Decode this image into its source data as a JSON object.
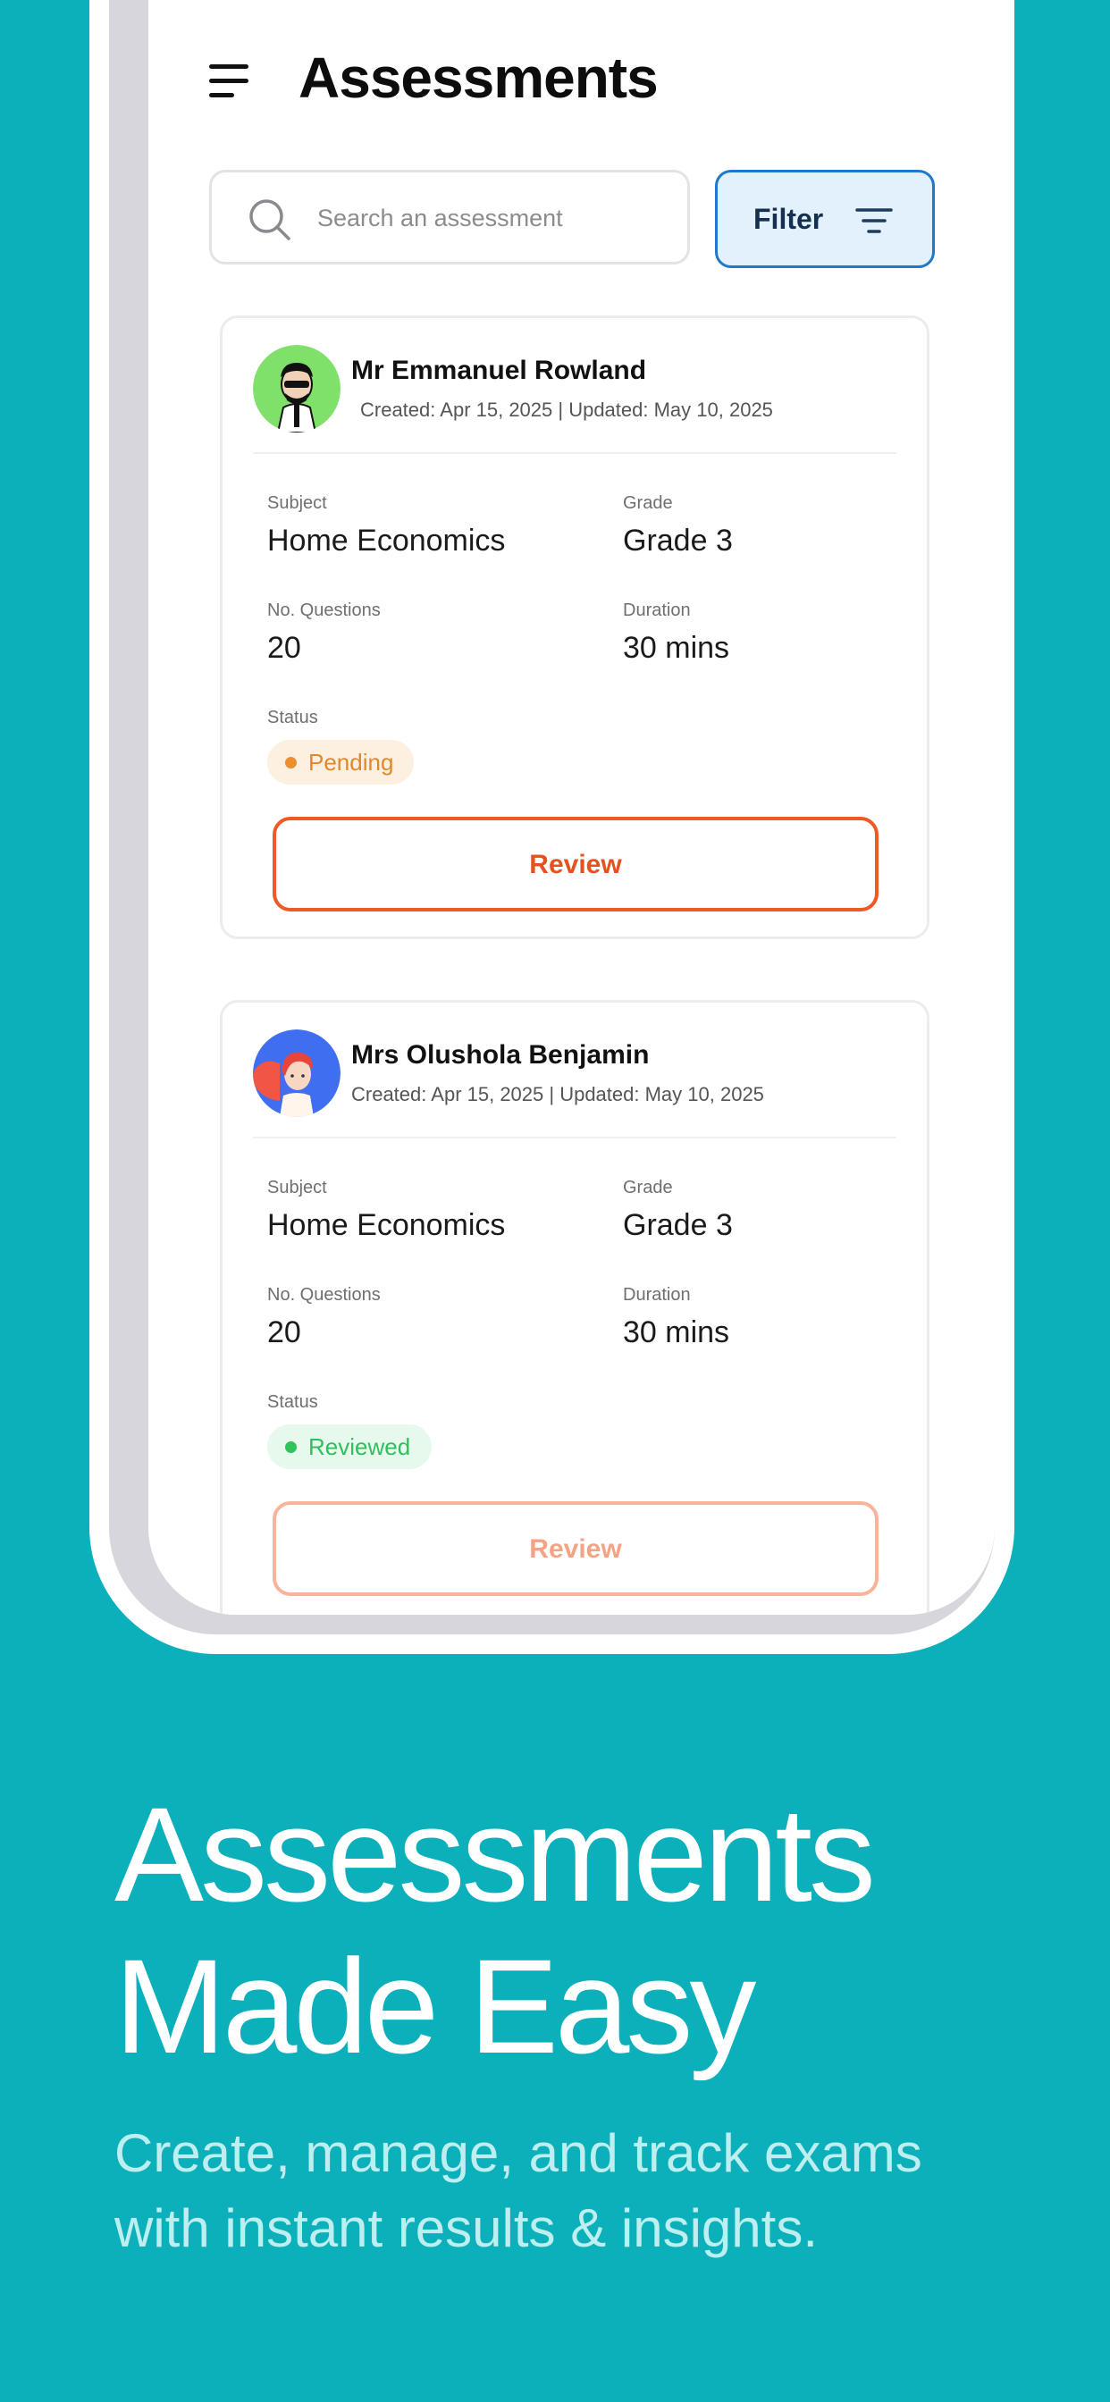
{
  "header": {
    "title": "Assessments",
    "menu_icon": "hamburger-menu-icon"
  },
  "search": {
    "placeholder": "Search an assessment",
    "icon": "search-icon"
  },
  "filter": {
    "label": "Filter",
    "icon": "filter-lines-icon"
  },
  "labels": {
    "subject": "Subject",
    "grade": "Grade",
    "questions": "No. Questions",
    "duration": "Duration",
    "status": "Status"
  },
  "assessments": [
    {
      "teacher": "Mr Emmanuel Rowland",
      "dates": "Created: Apr 15, 2025 | Updated: May 10, 2025",
      "subject": "Home Economics",
      "grade": "Grade 3",
      "questions": "20",
      "duration": "30 mins",
      "status": "Pending",
      "action": "Review"
    },
    {
      "teacher": "Mrs Olushola Benjamin",
      "dates": "Created: Apr 15, 2025 | Updated: May 10, 2025",
      "subject": "Home Economics",
      "grade": "Grade 3",
      "questions": "20",
      "duration": "30 mins",
      "status": "Reviewed",
      "action": "Review"
    }
  ],
  "marketing": {
    "headline_line1": "Assessments",
    "headline_line2": "Made Easy",
    "subline_line1": "Create, manage, and track exams",
    "subline_line2": "with instant results & insights."
  },
  "colors": {
    "background": "#0bb0bb",
    "accent_orange": "#ee5a24",
    "filter_blue": "#1f78c9",
    "pending": "#ec8f2d",
    "reviewed": "#2ec45c"
  }
}
